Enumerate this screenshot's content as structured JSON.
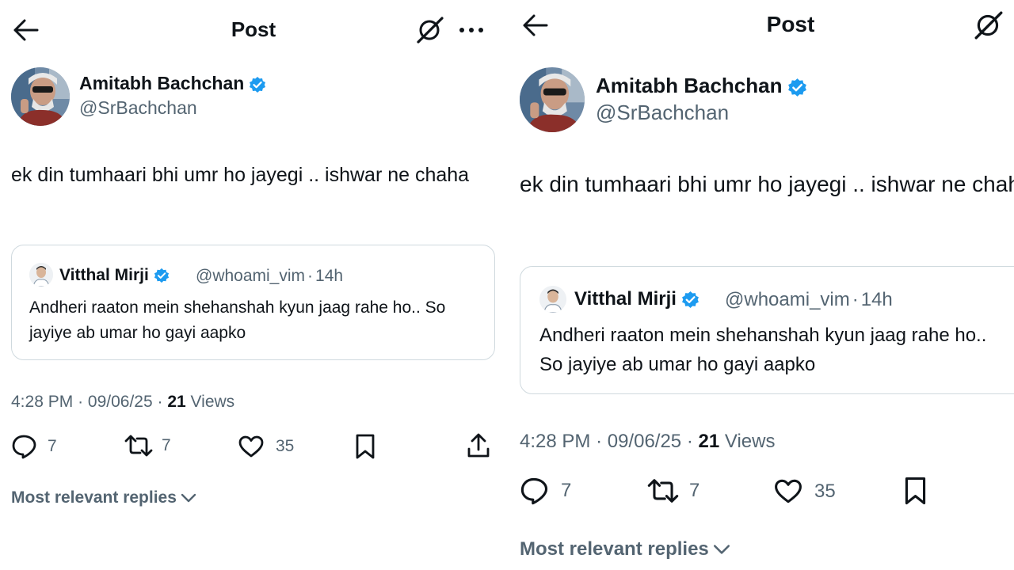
{
  "header": {
    "title": "Post"
  },
  "author": {
    "name": "Amitabh Bachchan",
    "handle": "@SrBachchan",
    "verified": true
  },
  "tweet": {
    "text": "ek din tumhaari bhi umr ho jayegi .. ishwar ne chaha"
  },
  "quoted": {
    "name": "Vitthal Mirji",
    "handle": "@whoami_vim",
    "separator": "·",
    "time": "14h",
    "text": "Andheri raaton mein shehanshah kyun jaag rahe ho.. So jayiye ab umar ho gayi aapko"
  },
  "meta": {
    "time": "4:28 PM",
    "date": "09/06/25",
    "separator": "·",
    "views_count": "21",
    "views_label": "Views"
  },
  "actions": {
    "replies": "7",
    "reposts": "7",
    "likes": "35"
  },
  "replies_sort": {
    "label": "Most relevant replies"
  },
  "colors": {
    "text": "#0f1419",
    "secondary": "#536471",
    "verified": "#1d9bf0",
    "border": "#cfd9de"
  }
}
